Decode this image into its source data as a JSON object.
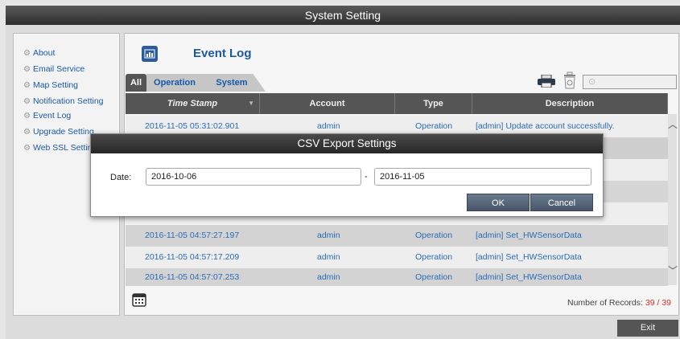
{
  "window": {
    "title": "System Setting",
    "exit_label": "Exit"
  },
  "sidebar": {
    "items": [
      {
        "label": "About",
        "icon": "gear-icon"
      },
      {
        "label": "Email Service",
        "icon": "gear-icon"
      },
      {
        "label": "Map Setting",
        "icon": "gear-icon"
      },
      {
        "label": "Notification Setting",
        "icon": "gear-icon"
      },
      {
        "label": "Event Log",
        "icon": "gear-icon",
        "active": true
      },
      {
        "label": "Upgrade Setting",
        "icon": "gear-icon"
      },
      {
        "label": "Web SSL Setting",
        "icon": "gear-icon"
      }
    ]
  },
  "main": {
    "title": "Event Log",
    "tabs": [
      {
        "label": "All",
        "active": true
      },
      {
        "label": "Operation"
      },
      {
        "label": "System"
      }
    ],
    "search": {
      "placeholder": ""
    },
    "table": {
      "columns": [
        "Time Stamp",
        "Account",
        "Type",
        "Description"
      ],
      "rows": [
        {
          "time": "2016-11-05 05:31:02.901",
          "account": "admin",
          "type": "Operation",
          "description": "[admin] Update account successfully."
        },
        {
          "time": "2016-11-05 04:57:27.197",
          "account": "admin",
          "type": "Operation",
          "description": "[admin] Set_HWSensorData"
        },
        {
          "time": "2016-11-05 04:57:17.209",
          "account": "admin",
          "type": "Operation",
          "description": "[admin] Set_HWSensorData"
        },
        {
          "time": "2016-11-05 04:57:07.253",
          "account": "admin",
          "type": "Operation",
          "description": "[admin] Set_HWSensorData"
        }
      ]
    },
    "records": {
      "label": "Number of Records:",
      "shown": "39",
      "separator": "/",
      "total": "39"
    }
  },
  "dialog": {
    "title": "CSV Export Settings",
    "date_label": "Date:",
    "from_value": "2016-10-06",
    "dash": "-",
    "to_value": "2016-11-05",
    "ok_label": "OK",
    "cancel_label": "Cancel"
  },
  "colors": {
    "accent_blue": "#1a58a8",
    "link_blue": "#2a6bb6",
    "header_dark": "#555555",
    "record_red": "#d0302a"
  }
}
